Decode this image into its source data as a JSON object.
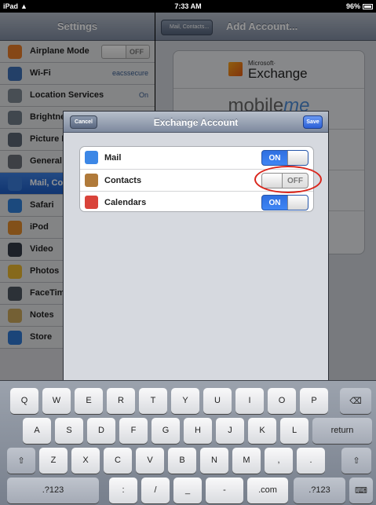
{
  "status_bar": {
    "device": "iPad",
    "time": "7:33 AM",
    "battery": "96%"
  },
  "settings_pane": {
    "title": "Settings",
    "items": [
      {
        "label": "Airplane Mode",
        "toggle": "OFF",
        "icon": "airplane-icon",
        "color": "#e57b28"
      },
      {
        "label": "Wi-Fi",
        "value": "eacssecure",
        "icon": "wifi-icon",
        "color": "#3d6fb3"
      },
      {
        "label": "Location Services",
        "value": "On",
        "icon": "location-icon",
        "color": "#7d8791"
      },
      {
        "label": "Brightne",
        "icon": "brightness-icon",
        "color": "#6e7a87"
      },
      {
        "label": "Picture F",
        "icon": "picture-frame-icon",
        "color": "#5b6572"
      },
      {
        "label": "General",
        "icon": "gear-icon",
        "color": "#6a6f77"
      },
      {
        "label": "Mail, Co",
        "icon": "mail-icon",
        "color": "#3a7ad8",
        "selected": true
      },
      {
        "label": "Safari",
        "icon": "safari-icon",
        "color": "#2f7fd8"
      },
      {
        "label": "iPod",
        "icon": "ipod-icon",
        "color": "#e18a2c"
      },
      {
        "label": "Video",
        "icon": "video-icon",
        "color": "#333a46"
      },
      {
        "label": "Photos",
        "icon": "photos-icon",
        "color": "#e7b52f"
      },
      {
        "label": "FaceTim",
        "icon": "facetime-icon",
        "color": "#4c5560"
      },
      {
        "label": "Notes",
        "icon": "notes-icon",
        "color": "#c9a55a"
      },
      {
        "label": "Store",
        "icon": "store-icon",
        "color": "#2f78d0"
      }
    ]
  },
  "detail_pane": {
    "back_label": "Mail, Contacts...",
    "title": "Add Account...",
    "providers": {
      "exchange_pre": "Microsoft·",
      "exchange_name": "Exchange",
      "mobileme_a": "mobile",
      "mobileme_b": "me"
    }
  },
  "modal": {
    "title": "Exchange Account",
    "cancel_label": "Cancel",
    "save_label": "Save",
    "services": [
      {
        "label": "Mail",
        "state": "ON",
        "icon": "mail-icon",
        "color": "#3c87e6"
      },
      {
        "label": "Contacts",
        "state": "OFF",
        "icon": "contacts-icon",
        "color": "#b07a3a"
      },
      {
        "label": "Calendars",
        "state": "ON",
        "icon": "calendar-icon",
        "color": "#d9433a"
      }
    ]
  },
  "keyboard": {
    "row1": [
      "Q",
      "W",
      "E",
      "R",
      "T",
      "Y",
      "U",
      "I",
      "O",
      "P"
    ],
    "row2": [
      "A",
      "S",
      "D",
      "F",
      "G",
      "H",
      "J",
      "K",
      "L"
    ],
    "row3": [
      "Z",
      "X",
      "C",
      "V",
      "B",
      "N",
      "M",
      ",",
      "."
    ],
    "row4": [
      ".?123",
      ":",
      "/",
      "_",
      "-",
      ".com",
      ".?123"
    ],
    "backspace": "⌫",
    "return_label": "return",
    "shift": "⇧",
    "hide_keyboard": "⌨"
  }
}
